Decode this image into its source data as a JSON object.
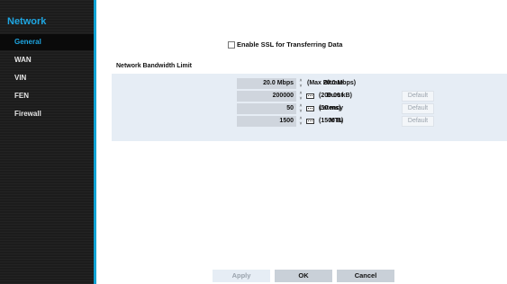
{
  "sidebar": {
    "title": "Network",
    "items": [
      {
        "label": "General",
        "active": true
      },
      {
        "label": "WAN",
        "active": false
      },
      {
        "label": "VIN",
        "active": false
      },
      {
        "label": "FEN",
        "active": false
      },
      {
        "label": "Firewall",
        "active": false
      }
    ]
  },
  "ssl": {
    "label": "Enable SSL for Transferring Data",
    "checked": false
  },
  "bandwidth": {
    "title": "Network Bandwidth Limit",
    "rows": [
      {
        "label": "Bitrate",
        "value": "20.0 Mbps",
        "note": "(Max 20.0 Mbps)",
        "has_keyboard": false,
        "default": ""
      },
      {
        "label": "Burst",
        "value": "200000",
        "note": "(200.00 kB)",
        "has_keyboard": true,
        "default": "Default"
      },
      {
        "label": "Latency",
        "value": "50",
        "note": "(50 ms)",
        "has_keyboard": true,
        "default": "Default"
      },
      {
        "label": "MTU",
        "value": "1500",
        "note": "(1500 B)",
        "has_keyboard": true,
        "default": "Default"
      }
    ]
  },
  "buttons": {
    "apply": "Apply",
    "ok": "OK",
    "cancel": "Cancel"
  },
  "colors": {
    "accent": "#11a3d4",
    "sidebar_bg": "#1c1c1c",
    "panel_bg": "#e6edf5"
  },
  "icons": {
    "spinner": "up-down-arrows-icon",
    "keyboard": "keyboard-icon",
    "checkbox": "checkbox-icon"
  }
}
